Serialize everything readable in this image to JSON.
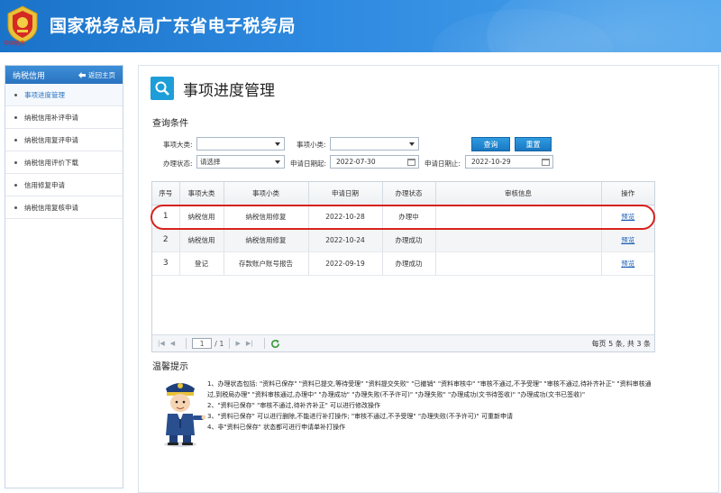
{
  "header": {
    "title": "国家税务总局广东省电子税务局",
    "logo_text": "中国税务",
    "logo_icon": "tax-emblem-icon"
  },
  "sidebar": {
    "title": "纳税信用",
    "back_label": "返回主页",
    "items": [
      {
        "label": "事项进度管理",
        "active": true
      },
      {
        "label": "纳税信用补评申请"
      },
      {
        "label": "纳税信用复评申请"
      },
      {
        "label": "纳税信用评价下载"
      },
      {
        "label": "信用修复申请"
      },
      {
        "label": "纳税信用复核申请"
      }
    ]
  },
  "page": {
    "title": "事项进度管理",
    "query_section": "查询条件"
  },
  "query": {
    "item_major_label": "事项大类:",
    "item_major_value": "",
    "item_minor_label": "事项小类:",
    "item_minor_value": "",
    "status_label": "办理状态:",
    "status_value": "请选择",
    "date_from_label": "申请日期起:",
    "date_from_value": "2022-07-30",
    "date_to_label": "申请日期止:",
    "date_to_value": "2022-10-29",
    "search_button": "查询",
    "reset_button": "重置"
  },
  "table": {
    "headers": [
      "序号",
      "事项大类",
      "事项小类",
      "申请日期",
      "办理状态",
      "审核信息",
      "操作"
    ],
    "rows": [
      {
        "seq": "1",
        "major": "纳税信用",
        "minor": "纳税信用修复",
        "date": "2022-10-28",
        "status": "办理中",
        "review": "",
        "action": "预览"
      },
      {
        "seq": "2",
        "major": "纳税信用",
        "minor": "纳税信用修复",
        "date": "2022-10-24",
        "status": "办理成功",
        "review": "",
        "action": "预览"
      },
      {
        "seq": "3",
        "major": "登记",
        "minor": "存款账户账号报告",
        "date": "2022-09-19",
        "status": "办理成功",
        "review": "",
        "action": "预览"
      }
    ]
  },
  "pager": {
    "current_page": "1",
    "total_pages": "/ 1",
    "summary": "每页 5 条, 共 3 条"
  },
  "tips": {
    "title": "温馨提示",
    "lines": [
      "1、办理状态包括: \"资料已保存\" \"资料已提交,等待受理\" \"资料提交失败\" \"已撤销\" \"资料审核中\" \"审核不通过,不予受理\" \"审核不通过,待补齐补正\" \"资料审核通过,到税局办理\" \"资料审核通过,办理中\" \"办理成功\" \"办理失败(不予许可)\" \"办理失败\" \"办理成功(文书待签收)\" \"办理成功(文书已签收)\"",
      "2、\"资料已保存\" \"审核不通过,待补齐补正\" 可以进行修改操作",
      "3、\"资料已保存\" 可以进行删除,不能进行补打操作; \"审核不通过,不予受理\" \"办理失败(不予许可)\" 可重新申请",
      "4、非\"资料已保存\" 状态都可进行申请单补打操作"
    ]
  },
  "colors": {
    "header_blue": "#1a73c9",
    "button_blue": "#1a78c2",
    "highlight_red": "#d8211d",
    "link_blue": "#1d5fb8"
  }
}
